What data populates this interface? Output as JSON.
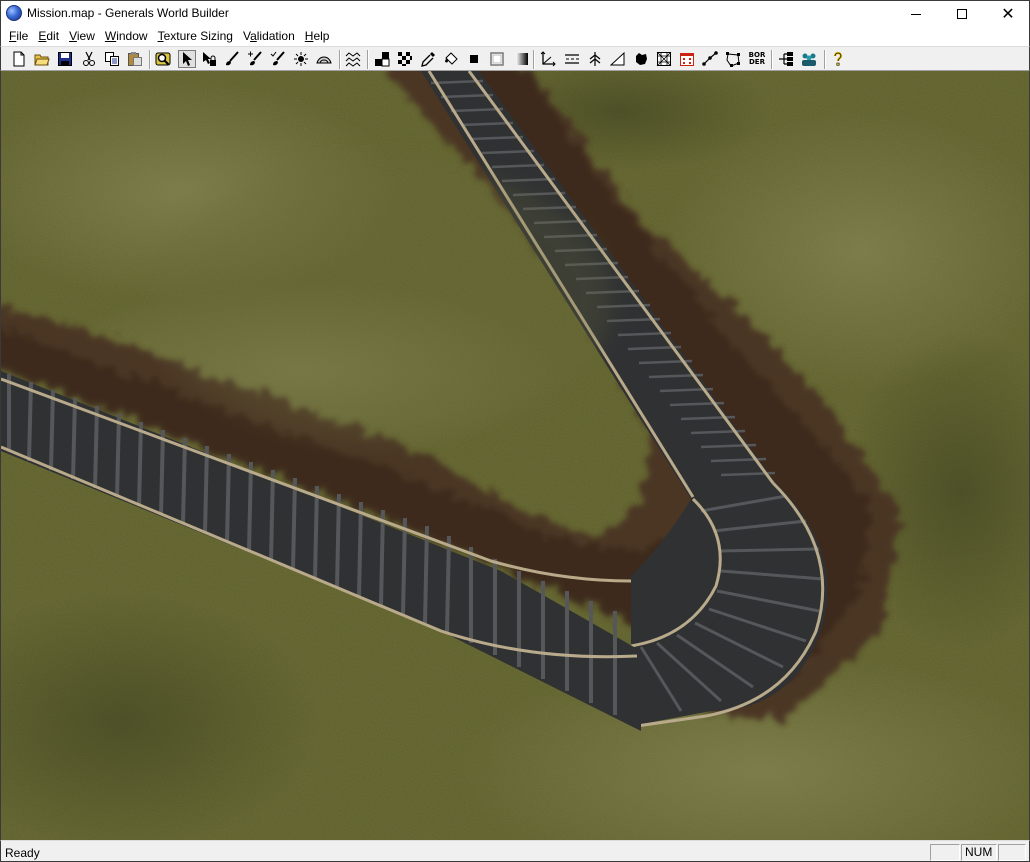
{
  "window": {
    "title": "Mission.map - Generals World Builder",
    "minimize_icon": "minimize-icon",
    "maximize_icon": "maximize-icon",
    "close_icon": "close-icon"
  },
  "menu": {
    "items": [
      {
        "label": "File",
        "mnemonic": "F"
      },
      {
        "label": "Edit",
        "mnemonic": "E"
      },
      {
        "label": "View",
        "mnemonic": "V"
      },
      {
        "label": "Window",
        "mnemonic": "W"
      },
      {
        "label": "Texture Sizing",
        "mnemonic": "T"
      },
      {
        "label": "Validation",
        "mnemonic": "a"
      },
      {
        "label": "Help",
        "mnemonic": "H"
      }
    ]
  },
  "toolbar": {
    "border_button_label_top": "BOR",
    "border_button_label_bottom": "DER",
    "tools": [
      "new-file-icon",
      "open-folder-icon",
      "save-icon",
      "cut-icon",
      "copy-icon",
      "paste-icon",
      "zoom-lens-icon",
      "pointer-icon",
      "hand-lock-icon",
      "brush-icon",
      "brush-add-icon",
      "brush-check-icon",
      "burst-icon",
      "hill-icon",
      "waves-icon",
      "checker-small-icon",
      "checker-icon",
      "eyedropper-icon",
      "fill-bucket-icon",
      "black-square-icon",
      "white-square-icon",
      "gradient-icon",
      "axis-icon",
      "road-icon",
      "tree-icon",
      "ramp-icon",
      "blob-icon",
      "grid-icon",
      "building-icon",
      "waypoint-icon",
      "polygon-icon",
      "border-icon",
      "team-tree-icon",
      "units-icon",
      "help-question-icon"
    ]
  },
  "status": {
    "text": "Ready",
    "pane_1": "",
    "pane_num": "NUM",
    "pane_3": ""
  },
  "colors": {
    "grass": "#5b5d33",
    "dirt": "#4a3322",
    "ties": "#2f3133",
    "rail": "#b8aa8a"
  }
}
